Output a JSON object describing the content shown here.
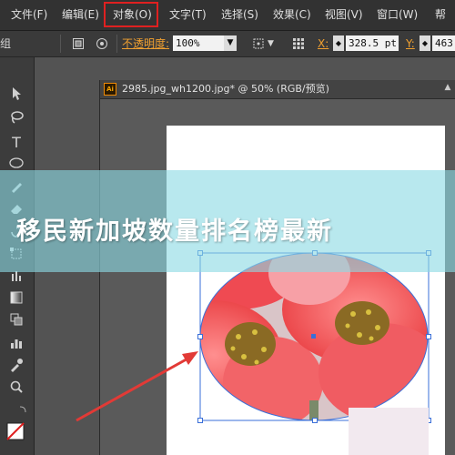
{
  "menu": {
    "items": [
      {
        "label": "文件(F)"
      },
      {
        "label": "编辑(E)"
      },
      {
        "label": "对象(O)"
      },
      {
        "label": "文字(T)"
      },
      {
        "label": "选择(S)"
      },
      {
        "label": "效果(C)"
      },
      {
        "label": "视图(V)"
      },
      {
        "label": "窗口(W)"
      },
      {
        "label": "帮"
      }
    ],
    "highlighted": "对象(O)"
  },
  "control_bar": {
    "group_label": "编组",
    "opacity_label": "不透明度:",
    "opacity_value": "100%",
    "x_label": "X:",
    "x_value": "328.5 pt",
    "y_label": "Y:",
    "y_value": "463"
  },
  "document": {
    "app_badge": "Ai",
    "title": "2985.jpg_wh1200.jpg* @ 50% (RGB/预览)",
    "zoom": "50%",
    "color_mode": "RGB/预览"
  },
  "banner": {
    "text": "移民新加坡数量排名榜最新"
  },
  "colors": {
    "menu_bg": "#323232",
    "highlight_border": "#e02020",
    "banner_bg": "#8cdae4",
    "selection": "#3a6fd8",
    "arrow": "#e23a36"
  },
  "tools": [
    "selection-tool",
    "lasso-tool",
    "type-tool",
    "ellipse-tool",
    "pencil-tool",
    "eraser-tool",
    "free-transform-tool",
    "graph-tool",
    "gradient-tool",
    "blend-tool",
    "column-graph-tool",
    "eyedropper-tool",
    "zoom-tool",
    "fill-stroke-swatch"
  ]
}
